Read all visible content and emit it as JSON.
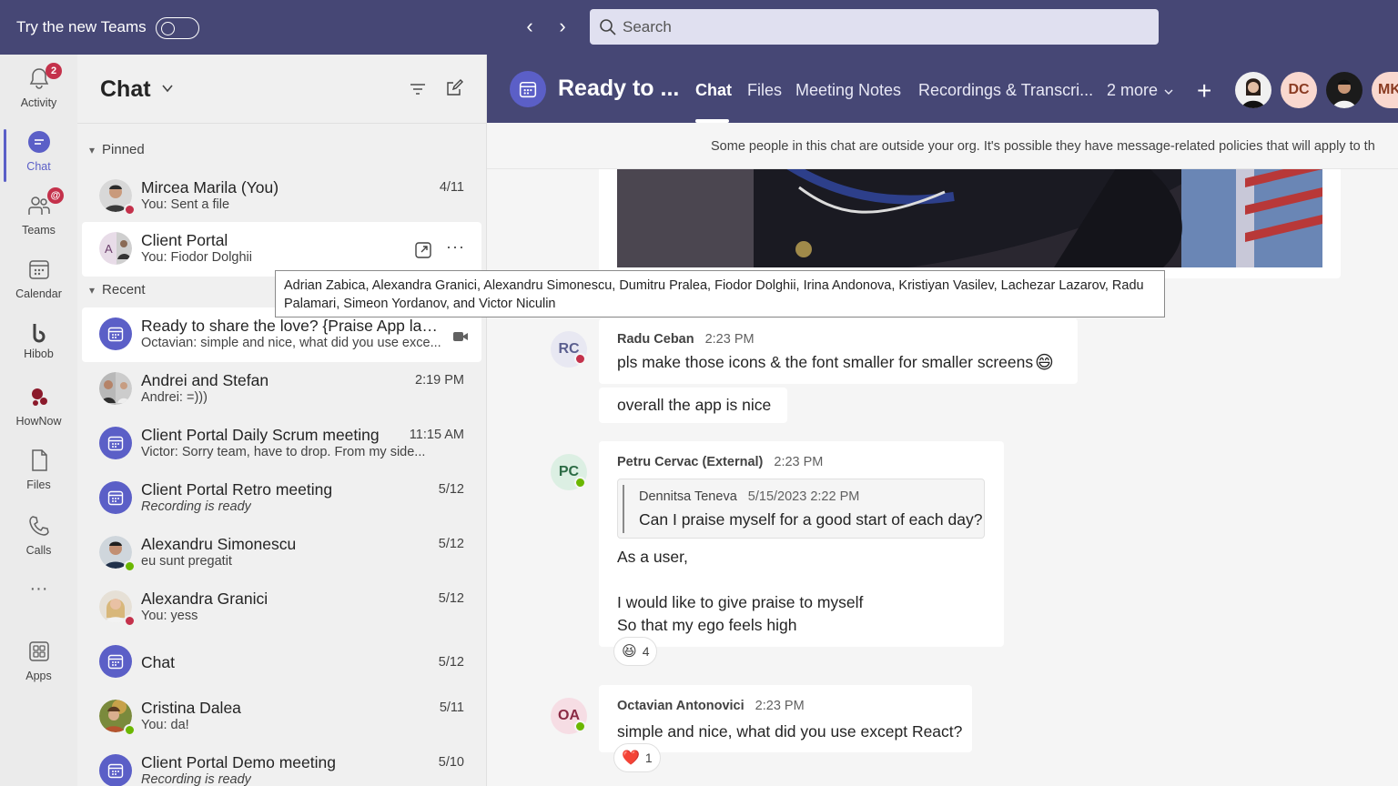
{
  "topbar": {
    "try_label": "Try the new Teams",
    "search_placeholder": "Search"
  },
  "rail": {
    "activity": {
      "label": "Activity",
      "badge": "2"
    },
    "chat": {
      "label": "Chat"
    },
    "teams": {
      "label": "Teams",
      "badge": "@"
    },
    "calendar": {
      "label": "Calendar"
    },
    "hibob": {
      "label": "Hibob"
    },
    "hownow": {
      "label": "HowNow"
    },
    "files": {
      "label": "Files"
    },
    "calls": {
      "label": "Calls"
    },
    "more": {
      "label": "···"
    },
    "apps": {
      "label": "Apps"
    }
  },
  "chatlist": {
    "title": "Chat",
    "pinned_label": "Pinned",
    "recent_label": "Recent",
    "pinned": [
      {
        "name": "Mircea Marila (You)",
        "sub": "You: Sent a file",
        "time": "4/11"
      },
      {
        "name": "Client Portal",
        "sub": "You: Fiodor Dolghii",
        "time": ""
      }
    ],
    "recent": [
      {
        "name": "Ready to share the love? {Praise App laun...",
        "sub": "Octavian: simple and nice, what did you use exce...",
        "time": ""
      },
      {
        "name": "Andrei and Stefan",
        "sub": "Andrei: =)))",
        "time": "2:19 PM"
      },
      {
        "name": "Client Portal Daily Scrum meeting",
        "sub": "Victor: Sorry team, have to drop. From my side...",
        "time": "11:15 AM"
      },
      {
        "name": "Client Portal Retro meeting",
        "sub": "Recording is ready",
        "time": "5/12"
      },
      {
        "name": "Alexandru Simonescu",
        "sub": "eu sunt pregatit",
        "time": "5/12"
      },
      {
        "name": "Alexandra Granici",
        "sub": "You: yess",
        "time": "5/12"
      },
      {
        "name": "Chat",
        "sub": "",
        "time": "5/12"
      },
      {
        "name": "Cristina Dalea",
        "sub": "You: da!",
        "time": "5/11"
      },
      {
        "name": "Client Portal Demo meeting",
        "sub": "Recording is ready",
        "time": "5/10"
      }
    ]
  },
  "tooltip": "Adrian Zabica, Alexandra Granici, Alexandru Simonescu, Dumitru Pralea, Fiodor Dolghii, Irina Andonova, Kristiyan Vasilev, Lachezar Lazarov, Radu Palamari, Simeon Yordanov, and Victor Niculin",
  "header": {
    "title": "Ready to ...",
    "tabs": [
      "Chat",
      "Files",
      "Meeting Notes",
      "Recordings & Transcri...",
      "2 more"
    ],
    "avatars": [
      "",
      "DC",
      "",
      "MK"
    ]
  },
  "banner": "Some people in this chat are outside your org. It's possible they have message-related policies that will apply to th",
  "messages": [
    {
      "initials": "RC",
      "author": "Radu Ceban",
      "time": "2:23 PM",
      "text": "pls make those icons & the font smaller for smaller screens",
      "emoji": "😄"
    },
    {
      "text": "overall the app is nice"
    },
    {
      "initials": "PC",
      "author": "Petru Cervac (External)",
      "time": "2:23 PM",
      "quote_author": "Dennitsa Teneva",
      "quote_time": "5/15/2023 2:22 PM",
      "quote_text": "Can I praise myself for a good start of each day?",
      "line1": "As a user,",
      "line2": "I would like to give praise to myself",
      "line3": "So that my ego feels high",
      "reaction_emoji": "😆",
      "reaction_count": "4"
    },
    {
      "initials": "OA",
      "author": "Octavian Antonovici",
      "time": "2:23 PM",
      "text": "simple and nice, what did you use except React?",
      "reaction_emoji": "❤️",
      "reaction_count": "1"
    }
  ]
}
